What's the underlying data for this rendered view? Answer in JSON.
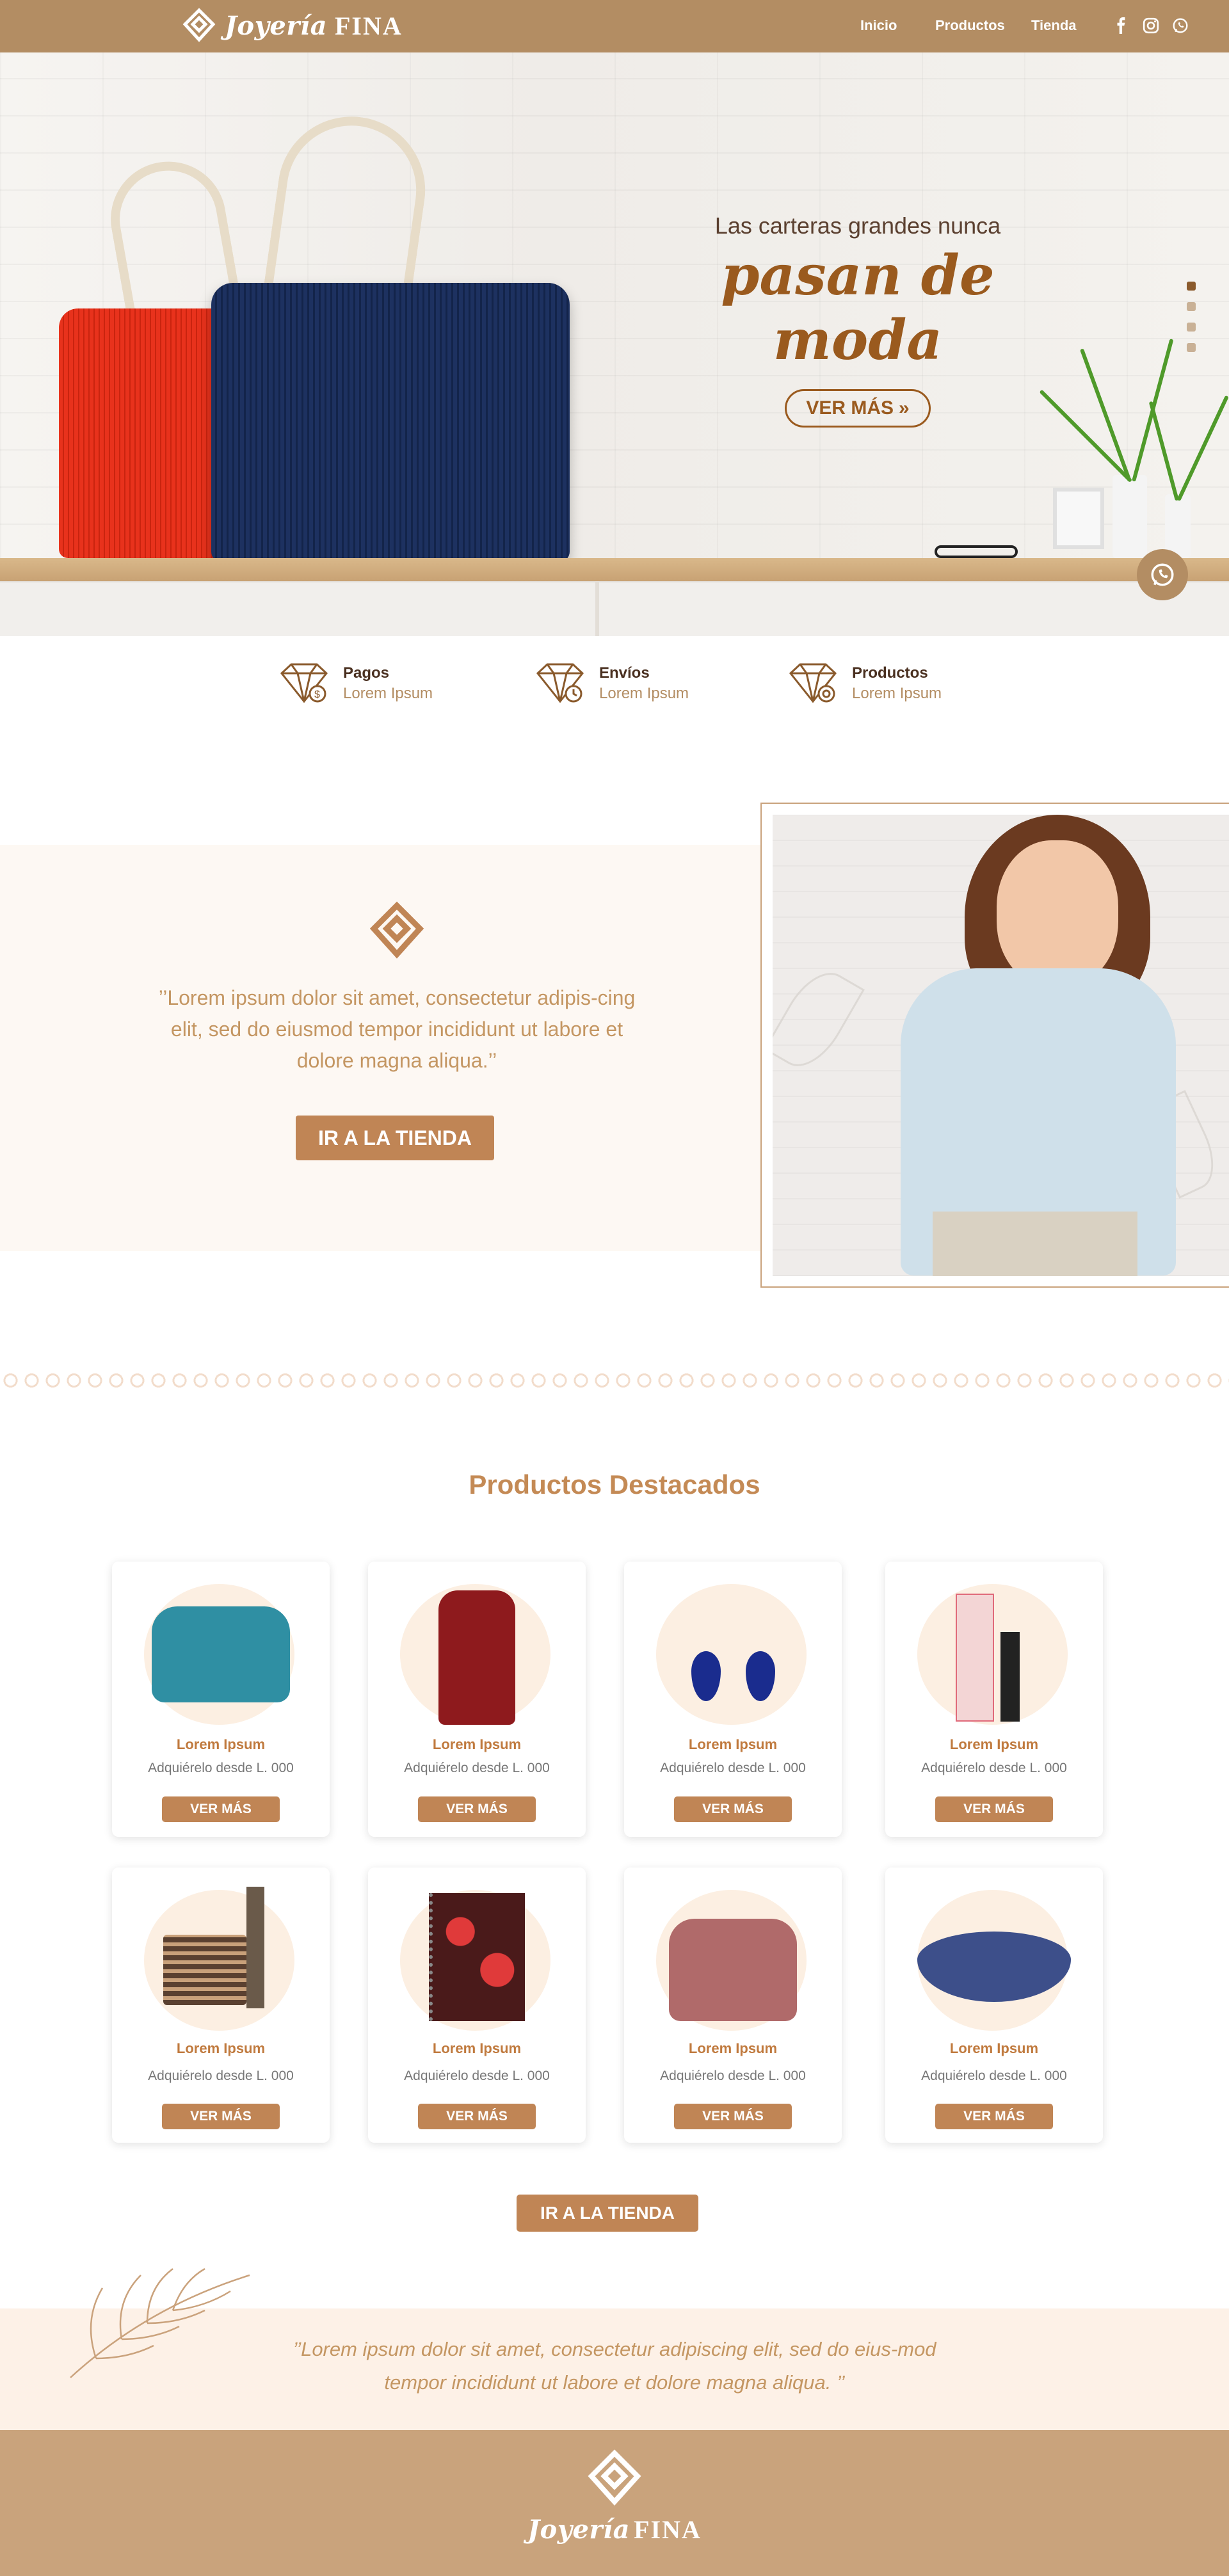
{
  "brand": {
    "script": "Joyería",
    "caps": "FINA"
  },
  "nav": {
    "links": [
      "Inicio",
      "Productos",
      "Tienda"
    ]
  },
  "socials": [
    "facebook-icon",
    "instagram-icon",
    "whatsapp-icon"
  ],
  "hero": {
    "subtitle": "Las carteras grandes nunca",
    "title": "pasan de moda",
    "button": "VER MÁS"
  },
  "features": [
    {
      "title": "Pagos",
      "subtitle": "Lorem Ipsum"
    },
    {
      "title": "Envíos",
      "subtitle": "Lorem Ipsum"
    },
    {
      "title": "Productos",
      "subtitle": "Lorem Ipsum"
    }
  ],
  "about": {
    "quote": "’’Lorem ipsum dolor sit amet, consectetur adipis-cing elit, sed do eiusmod tempor incididunt ut labore et dolore magna aliqua.’’",
    "button": "IR A LA TIENDA"
  },
  "products": {
    "title": "Productos Destacados",
    "items": [
      {
        "name": "Lorem Ipsum",
        "price": "Adquiérelo desde L. 000",
        "button": "VER MÁS"
      },
      {
        "name": "Lorem Ipsum",
        "price": "Adquiérelo desde L. 000",
        "button": "VER MÁS"
      },
      {
        "name": "Lorem Ipsum",
        "price": "Adquiérelo desde L. 000",
        "button": "VER MÁS"
      },
      {
        "name": "Lorem Ipsum",
        "price": "Adquiérelo desde L. 000",
        "button": "VER MÁS"
      },
      {
        "name": "Lorem Ipsum",
        "price": "Adquiérelo desde L. 000",
        "button": "VER MÁS"
      },
      {
        "name": "Lorem Ipsum",
        "price": "Adquiérelo desde L. 000",
        "button": "VER MÁS"
      },
      {
        "name": "Lorem Ipsum",
        "price": "Adquiérelo desde L. 000",
        "button": "VER MÁS"
      },
      {
        "name": "Lorem Ipsum",
        "price": "Adquiérelo desde L. 000",
        "button": "VER MÁS"
      }
    ],
    "store_button": "IR A LA TIENDA"
  },
  "testimonial": "’’Lorem ipsum dolor sit amet, consectetur adipiscing elit, sed do eius-mod tempor incididunt ut labore et dolore magna aliqua. ’’",
  "colors": {
    "primary": "#b38d63",
    "accent": "#c08555",
    "text": "#8a5a2c",
    "light": "#fdf8f3"
  }
}
